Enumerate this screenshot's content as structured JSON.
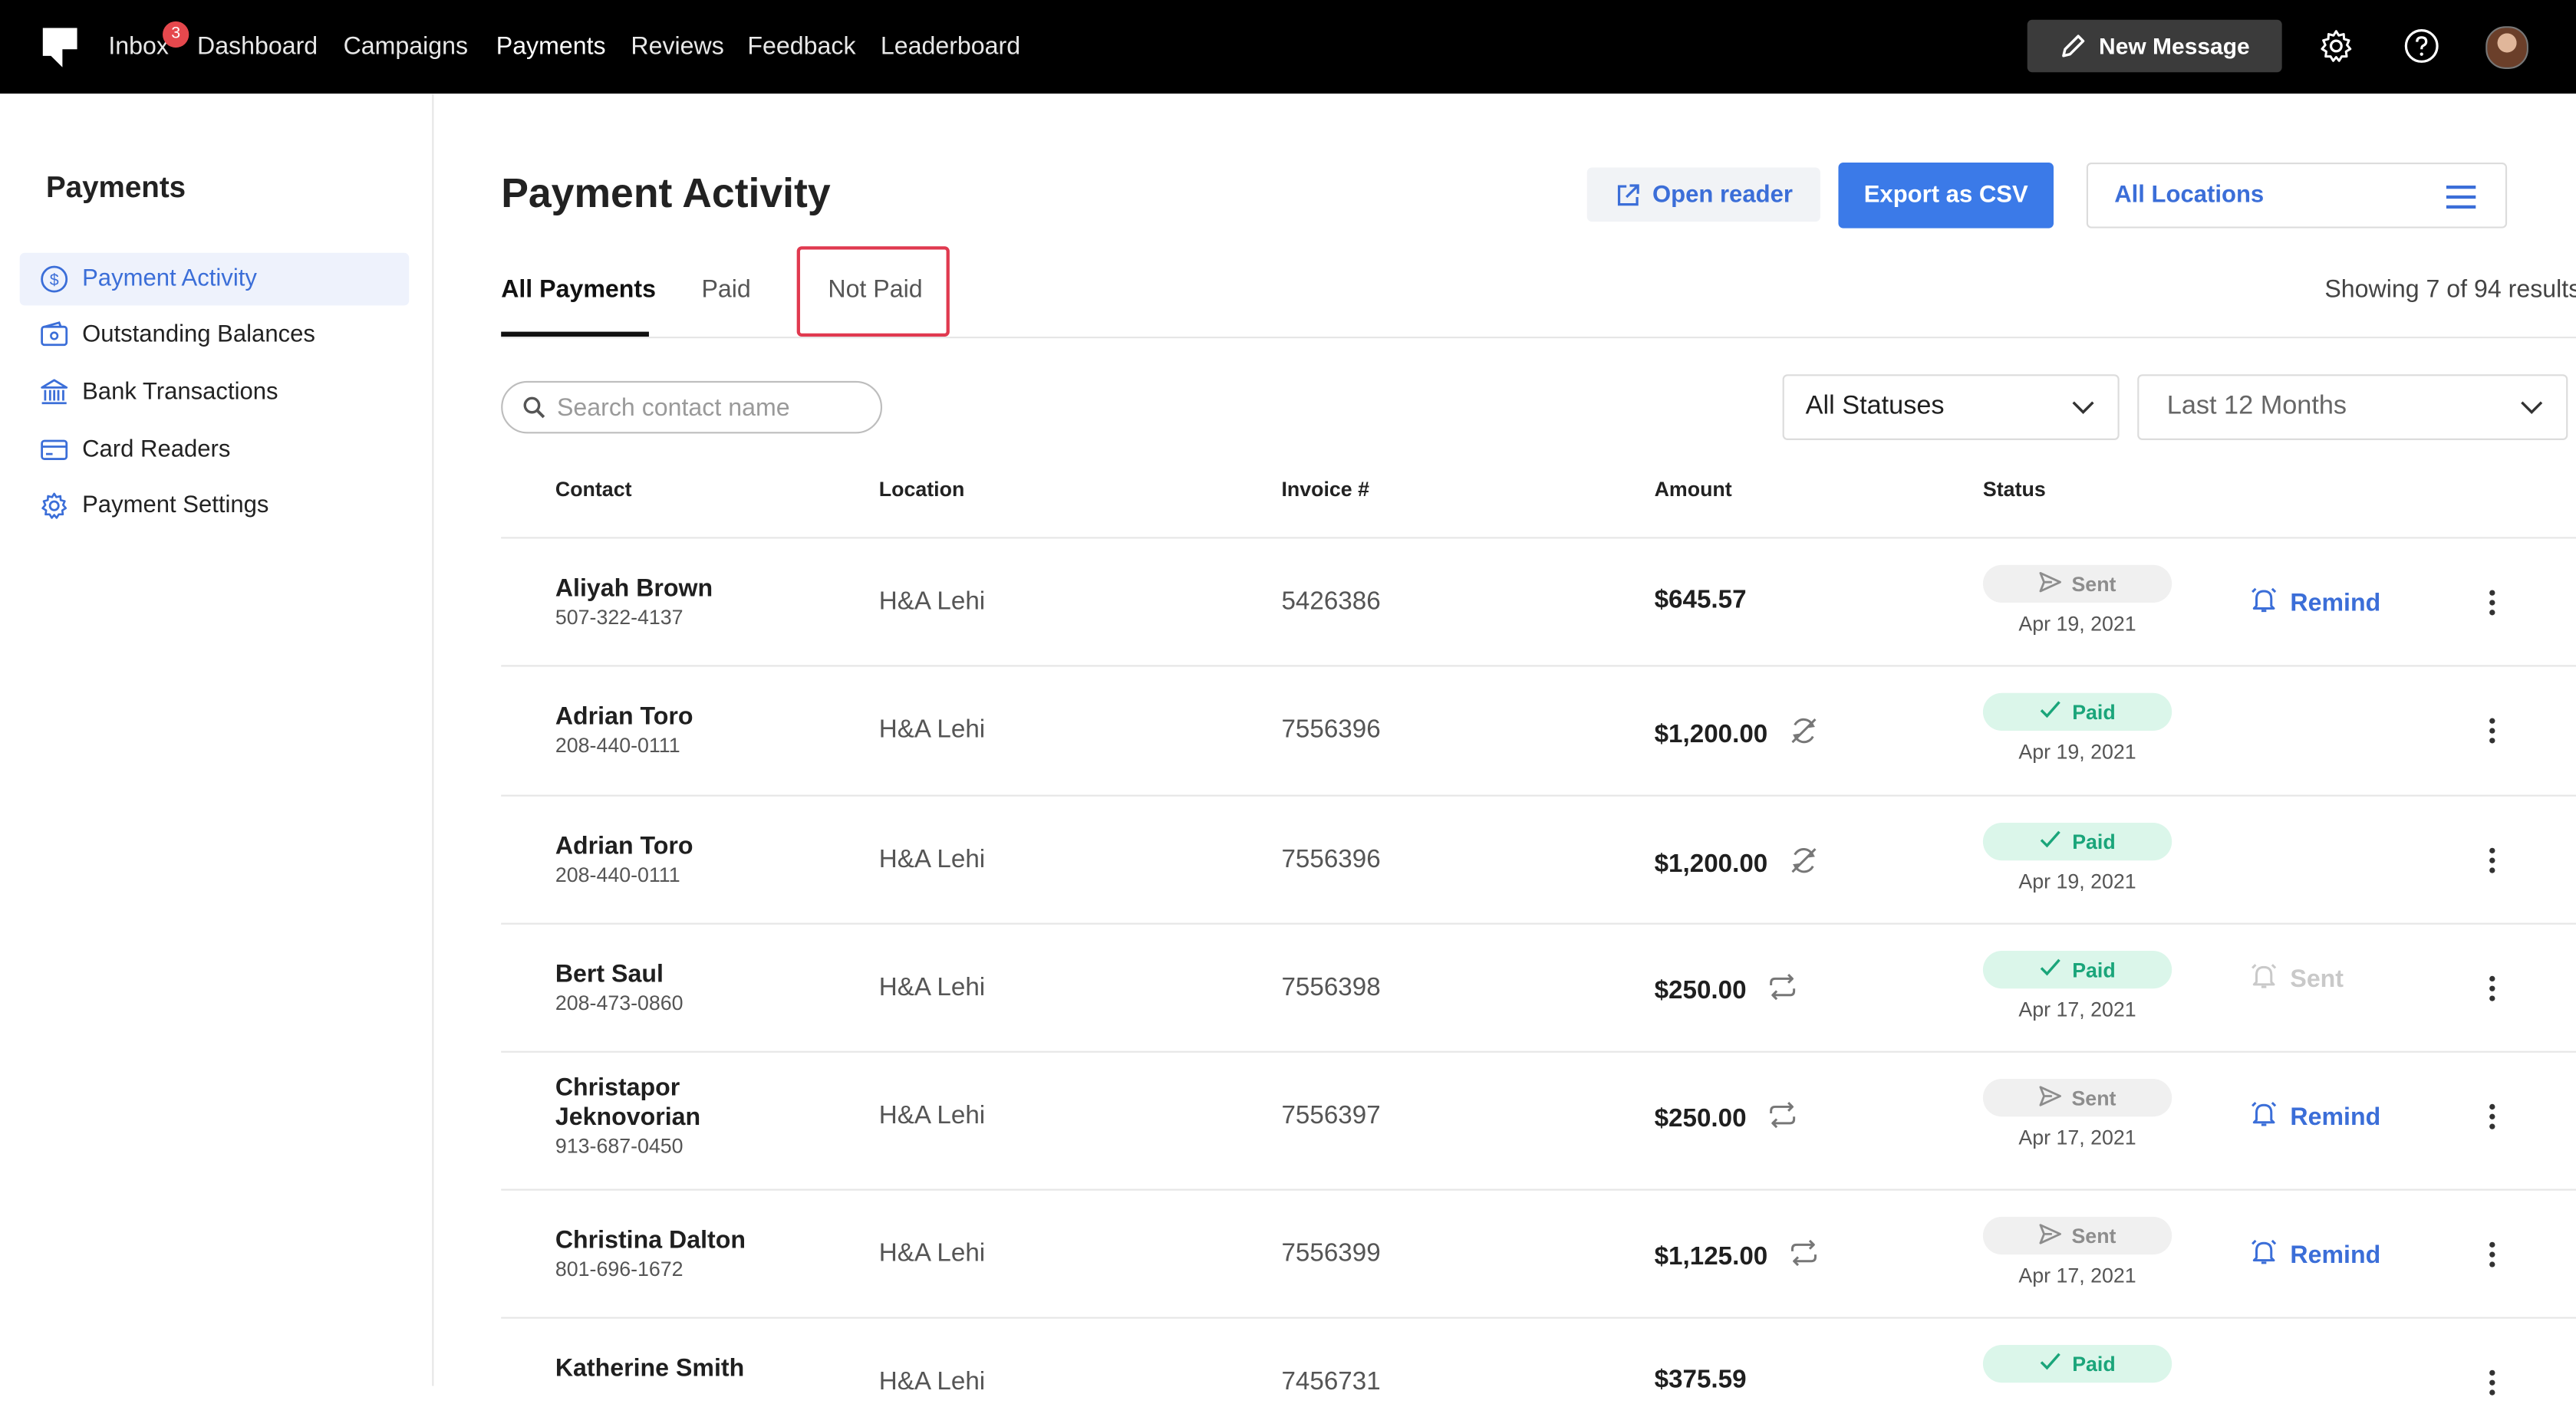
{
  "nav": {
    "inbox": "Inbox",
    "inbox_badge": "3",
    "dashboard": "Dashboard",
    "campaigns": "Campaigns",
    "payments": "Payments",
    "reviews": "Reviews",
    "feedback": "Feedback",
    "leaderboard": "Leaderboard",
    "new_message": "New Message"
  },
  "sidebar": {
    "title": "Payments",
    "items": [
      {
        "label": "Payment Activity",
        "icon": "dollar-circle-icon"
      },
      {
        "label": "Outstanding Balances",
        "icon": "wallet-icon"
      },
      {
        "label": "Bank Transactions",
        "icon": "bank-icon"
      },
      {
        "label": "Card Readers",
        "icon": "card-icon"
      },
      {
        "label": "Payment Settings",
        "icon": "gear-icon"
      }
    ]
  },
  "header": {
    "title": "Payment Activity",
    "open_reader": "Open reader",
    "export_csv": "Export as CSV",
    "location": "All Locations"
  },
  "tabs": [
    "All Payments",
    "Paid",
    "Not Paid"
  ],
  "showing": "Showing 7 of 94 results",
  "filters": {
    "search_placeholder": "Search contact name",
    "status": "All Statuses",
    "period": "Last 12 Months"
  },
  "table": {
    "columns": [
      "Contact",
      "Location",
      "Invoice #",
      "Amount",
      "Status"
    ],
    "rows": [
      {
        "name": "Aliyah Brown",
        "phone": "507-322-4137",
        "location": "H&A Lehi",
        "invoice": "5426386",
        "amount": "$645.57",
        "amount_icon": "none",
        "status": "Sent",
        "date": "Apr 19, 2021",
        "action": "Remind"
      },
      {
        "name": "Adrian Toro",
        "phone": "208-440-0111",
        "location": "H&A Lehi",
        "invoice": "7556396",
        "amount": "$1,200.00",
        "amount_icon": "no-sync-icon",
        "status": "Paid",
        "date": "Apr 19, 2021",
        "action": ""
      },
      {
        "name": "Adrian Toro",
        "phone": "208-440-0111",
        "location": "H&A Lehi",
        "invoice": "7556396",
        "amount": "$1,200.00",
        "amount_icon": "no-sync-icon",
        "status": "Paid",
        "date": "Apr 19, 2021",
        "action": ""
      },
      {
        "name": "Bert Saul",
        "phone": "208-473-0860",
        "location": "H&A Lehi",
        "invoice": "7556398",
        "amount": "$250.00",
        "amount_icon": "recurring-icon",
        "status": "Paid",
        "date": "Apr 17, 2021",
        "action": "Sent"
      },
      {
        "name": "Christapor Jeknovorian",
        "phone": "913-687-0450",
        "location": "H&A Lehi",
        "invoice": "7556397",
        "amount": "$250.00",
        "amount_icon": "recurring-icon",
        "status": "Sent",
        "date": "Apr 17, 2021",
        "action": "Remind"
      },
      {
        "name": "Christina Dalton",
        "phone": "801-696-1672",
        "location": "H&A Lehi",
        "invoice": "7556399",
        "amount": "$1,125.00",
        "amount_icon": "recurring-icon",
        "status": "Sent",
        "date": "Apr 17, 2021",
        "action": "Remind"
      },
      {
        "name": "Katherine Smith",
        "phone": "",
        "location": "H&A Lehi",
        "invoice": "7456731",
        "amount": "$375.59",
        "amount_icon": "none",
        "status": "Paid",
        "date": "",
        "action": ""
      }
    ]
  },
  "colors": {
    "accent": "#3b6ed8",
    "export_button": "#3b7ae8",
    "paid_bg": "#dbf6ea",
    "paid_text": "#1aa57a",
    "highlight": "#e0394f"
  }
}
